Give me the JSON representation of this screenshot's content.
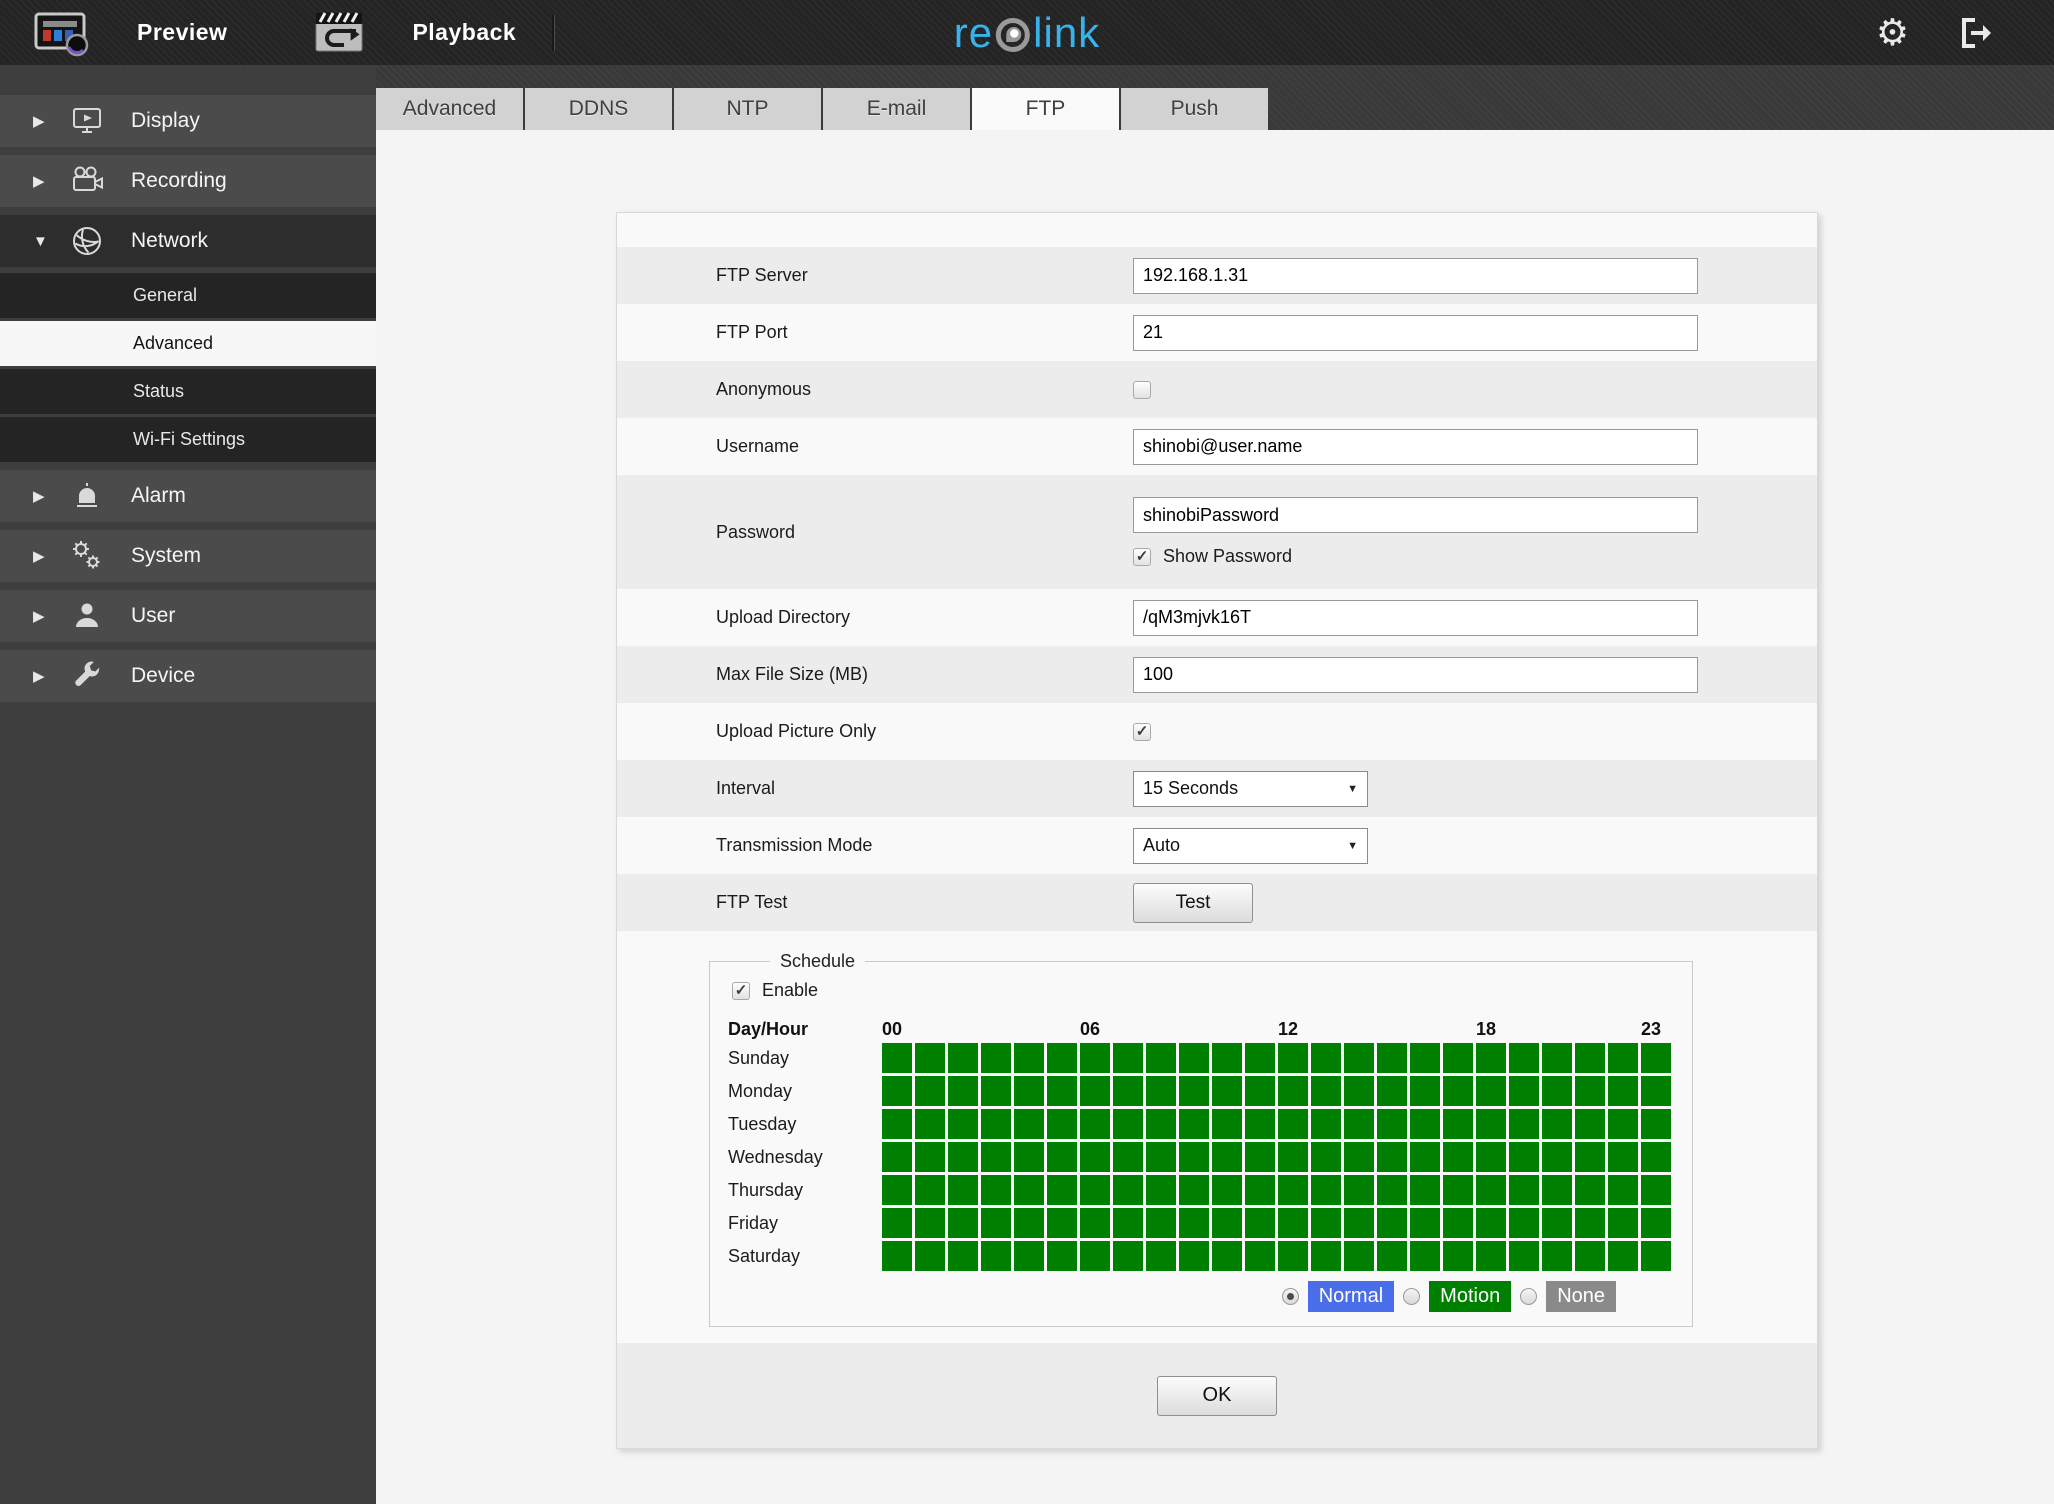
{
  "topbar": {
    "preview_label": "Preview",
    "playback_label": "Playback",
    "logo_part1": "re",
    "logo_part3": "link",
    "logo_accent_color": "#38b2ea",
    "logo_o_color": "#9a9a9a"
  },
  "sidebar": {
    "items": [
      {
        "label": "Display",
        "icon": "display-monitor-icon",
        "expanded": false
      },
      {
        "label": "Recording",
        "icon": "recording-camera-icon",
        "expanded": false
      },
      {
        "label": "Network",
        "icon": "network-globe-icon",
        "expanded": true,
        "children": [
          {
            "label": "General",
            "selected": false
          },
          {
            "label": "Advanced",
            "selected": true
          },
          {
            "label": "Status",
            "selected": false
          },
          {
            "label": "Wi-Fi Settings",
            "selected": false
          }
        ]
      },
      {
        "label": "Alarm",
        "icon": "alarm-siren-icon",
        "expanded": false
      },
      {
        "label": "System",
        "icon": "system-gears-icon",
        "expanded": false
      },
      {
        "label": "User",
        "icon": "user-icon",
        "expanded": false
      },
      {
        "label": "Device",
        "icon": "device-wrench-icon",
        "expanded": false
      }
    ]
  },
  "tabs": [
    {
      "label": "Advanced",
      "active": false
    },
    {
      "label": "DDNS",
      "active": false
    },
    {
      "label": "NTP",
      "active": false
    },
    {
      "label": "E-mail",
      "active": false
    },
    {
      "label": "FTP",
      "active": true
    },
    {
      "label": "Push",
      "active": false
    }
  ],
  "form": {
    "ftp_server": {
      "label": "FTP Server",
      "value": "192.168.1.31"
    },
    "ftp_port": {
      "label": "FTP Port",
      "value": "21"
    },
    "anonymous": {
      "label": "Anonymous",
      "checked": false
    },
    "username": {
      "label": "Username",
      "value": "shinobi@user.name"
    },
    "password": {
      "label": "Password",
      "value": "shinobiPassword",
      "show_password_label": "Show Password",
      "show_password_checked": true
    },
    "upload_directory": {
      "label": "Upload Directory",
      "value": "/qM3mjvk16T"
    },
    "max_file_size": {
      "label": "Max File Size (MB)",
      "value": "100"
    },
    "upload_picture_only": {
      "label": "Upload Picture Only",
      "checked": true
    },
    "interval": {
      "label": "Interval",
      "value": "15 Seconds"
    },
    "transmission_mode": {
      "label": "Transmission Mode",
      "value": "Auto"
    },
    "ftp_test": {
      "label": "FTP Test",
      "button_label": "Test"
    },
    "ok_button_label": "OK"
  },
  "schedule": {
    "legend": "Schedule",
    "enable_label": "Enable",
    "enable_checked": true,
    "day_hour_label": "Day/Hour",
    "hour_labels": [
      {
        "text": "00",
        "col": 0
      },
      {
        "text": "06",
        "col": 6
      },
      {
        "text": "12",
        "col": 12
      },
      {
        "text": "18",
        "col": 18
      },
      {
        "text": "23",
        "col": 23
      }
    ],
    "days": [
      "Sunday",
      "Monday",
      "Tuesday",
      "Wednesday",
      "Thursday",
      "Friday",
      "Saturday"
    ],
    "hours_per_day": 24,
    "cell_fill_color": "#008000",
    "modes": [
      {
        "label": "Normal",
        "color": "#4a6ee9",
        "selected": true
      },
      {
        "label": "Motion",
        "color": "#008000",
        "selected": false
      },
      {
        "label": "None",
        "color": "#8a8a8a",
        "selected": false
      }
    ]
  }
}
